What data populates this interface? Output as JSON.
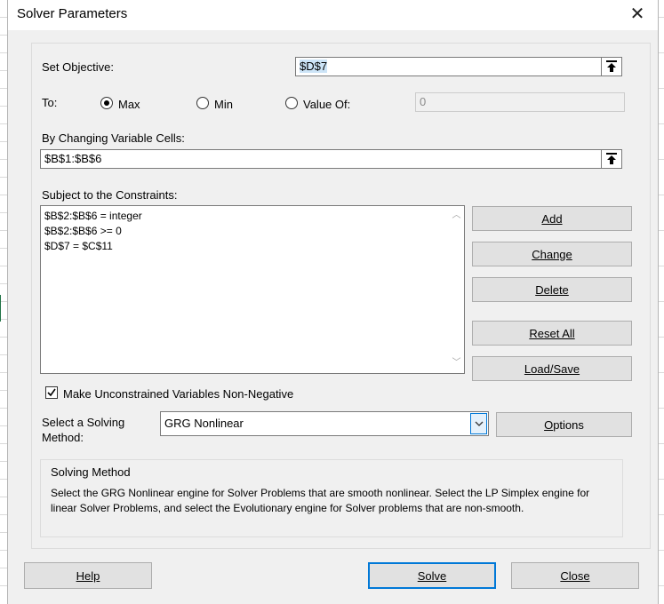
{
  "window": {
    "title": "Solver Parameters"
  },
  "objective": {
    "label": "Set Objective:",
    "value": "$D$7"
  },
  "to": {
    "label": "To:",
    "options": [
      {
        "label": "Max",
        "checked": true
      },
      {
        "label": "Min",
        "checked": false
      },
      {
        "label": "Value Of:",
        "checked": false
      }
    ],
    "value_of": "0"
  },
  "changing": {
    "label": "By Changing Variable Cells:",
    "value": "$B$1:$B$6"
  },
  "constraints": {
    "label": "Subject to the Constraints:",
    "items": [
      "$B$2:$B$6 = integer",
      "$B$2:$B$6 >= 0",
      "$D$7 = $C$11"
    ]
  },
  "constraint_buttons": {
    "add": "Add",
    "change": "Change",
    "delete": "Delete",
    "reset_all": "Reset All",
    "load_save": "Load/Save"
  },
  "nonneg": {
    "label": "Make Unconstrained Variables Non-Negative",
    "checked": true
  },
  "method": {
    "label_line1": "Select a Solving",
    "label_line2": "Method:",
    "value": "GRG Nonlinear",
    "options_button": "Options"
  },
  "solving_method": {
    "title": "Solving Method",
    "description": "Select the GRG Nonlinear engine for Solver Problems that are smooth nonlinear. Select the LP Simplex engine for linear Solver Problems, and select the Evolutionary engine for Solver problems that are non-smooth."
  },
  "footer": {
    "help": "Help",
    "solve": "Solve",
    "close": "Close"
  },
  "colors": {
    "accent": "#0078d7",
    "dialog_bg": "#f0f0f0",
    "button_bg": "#e1e1e1"
  }
}
